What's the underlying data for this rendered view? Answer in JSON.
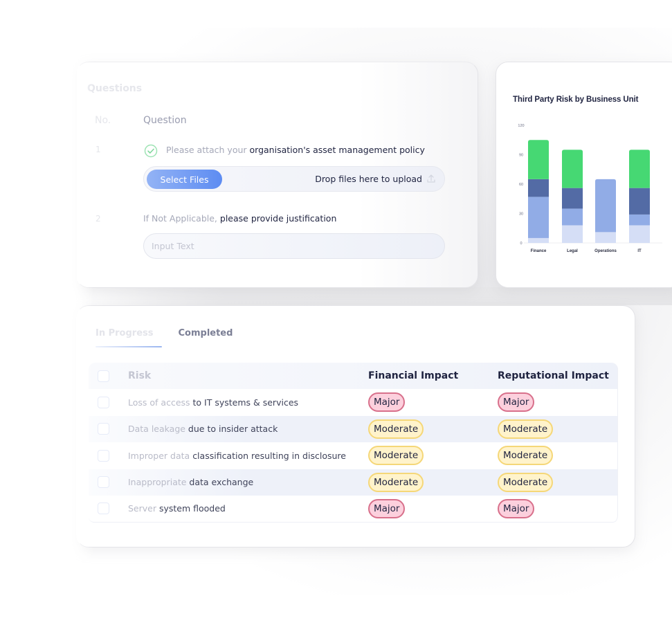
{
  "questions_card": {
    "title": "Questions",
    "columns": {
      "no": "No.",
      "question": "Question"
    },
    "items": [
      {
        "number": "1",
        "text_light": "Please attach your ",
        "text_dark": "organisation's asset management policy",
        "status_icon": "check-circle-icon",
        "upload": {
          "button_label": "Select Files",
          "drop_text": "Drop files here to upload",
          "icon": "upload-icon"
        }
      },
      {
        "number": "2",
        "text_light": "If Not Applicable, ",
        "text_dark": "please provide justification",
        "input": {
          "value": "",
          "placeholder": "Input Text"
        }
      }
    ]
  },
  "chart_card": {
    "colors": {
      "green": "#46d873",
      "dark_blue": "#536ba5",
      "mid_blue": "#91ace6",
      "light_blue": "#d5def6"
    }
  },
  "chart_data": {
    "type": "bar",
    "stacked": true,
    "title": "Third Party Risk by Business Unit",
    "xlabel": "",
    "ylabel": "",
    "categories": [
      "Finance",
      "Legal",
      "Operations",
      "IT"
    ],
    "ylim": [
      0,
      120
    ],
    "yticks": [
      0,
      30,
      60,
      90,
      120
    ],
    "grid": false,
    "legend": "none",
    "series": [
      {
        "name": "Light blue",
        "color": "#d5def6",
        "values": [
          5,
          18,
          11,
          18
        ]
      },
      {
        "name": "Medium blue",
        "color": "#91ace6",
        "values": [
          42,
          17,
          54,
          11
        ]
      },
      {
        "name": "Dark blue",
        "color": "#536ba5",
        "values": [
          18,
          21,
          0,
          27
        ]
      },
      {
        "name": "Green",
        "color": "#46d873",
        "values": [
          40,
          39,
          0,
          39
        ]
      }
    ]
  },
  "risk_table": {
    "tabs": [
      {
        "label": "In Progress",
        "active": true
      },
      {
        "label": "Completed",
        "active": false
      }
    ],
    "columns": {
      "risk": "Risk",
      "financial": "Financial Impact",
      "reputational": "Reputational Impact"
    },
    "rows": [
      {
        "risk_light": "Loss of access ",
        "risk_dark": "to IT systems & services",
        "financial": "Major",
        "reputational": "Major",
        "checked": false
      },
      {
        "risk_light": "Data leakage ",
        "risk_dark": "due to insider attack",
        "financial": "Moderate",
        "reputational": "Moderate",
        "checked": false
      },
      {
        "risk_light": "Improper data ",
        "risk_dark": "classification resulting in disclosure",
        "financial": "Moderate",
        "reputational": "Moderate",
        "checked": false
      },
      {
        "risk_light": "Inappropriate ",
        "risk_dark": "data exchange",
        "financial": "Moderate",
        "reputational": "Moderate",
        "checked": false
      },
      {
        "risk_light": "Server ",
        "risk_dark": "system flooded",
        "financial": "Major",
        "reputational": "Major",
        "checked": false
      }
    ],
    "badge_colors": {
      "Major": {
        "bg": "#fcd0dd",
        "border": "#d8708b"
      },
      "Moderate": {
        "bg": "#fff3cb",
        "border": "#f5d778"
      }
    }
  }
}
